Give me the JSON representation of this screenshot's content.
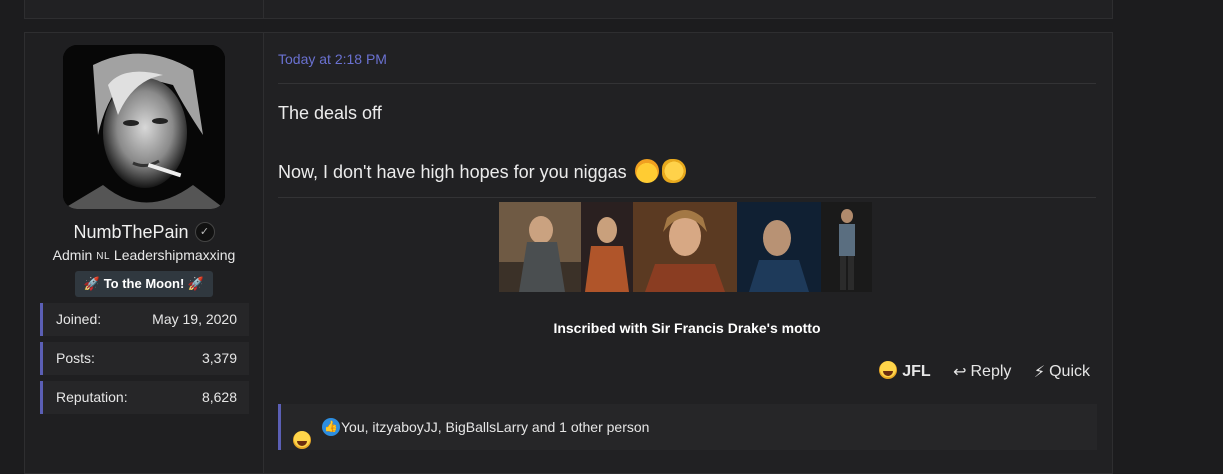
{
  "post": {
    "timestamp": "Today at 2:18 PM",
    "line1": "The deals off",
    "line2": "Now, I don't have high hopes for you niggas",
    "line2_emojis": [
      "exploding-head-emoji",
      "ok-hand-emoji"
    ]
  },
  "user": {
    "name": "NumbThePain",
    "title_prefix": "Admin",
    "title_flag": "NL",
    "title_suffix": "Leadershipmaxxing",
    "banner": "🚀 To the Moon! 🚀",
    "stats": [
      {
        "label": "Joined:",
        "value": "May 19, 2020"
      },
      {
        "label": "Posts:",
        "value": "3,379"
      },
      {
        "label": "Reputation:",
        "value": "8,628"
      }
    ]
  },
  "signature": {
    "caption": "Inscribed with Sir Francis Drake's motto",
    "images": [
      "gif-character-1",
      "gif-character-2",
      "gif-character-3",
      "gif-character-4",
      "gif-character-5"
    ]
  },
  "actions": {
    "jfl": "JFL",
    "reply": "Reply",
    "quick": "Quick"
  },
  "reactions": {
    "text": "You, itzyaboyJJ, BigBallsLarry and 1 other person",
    "icons": [
      "laughing-face-icon",
      "thumbs-up-icon"
    ]
  },
  "colors": {
    "accent": "#5b5fb5",
    "timestamp": "#6a71d0",
    "background": "#1c1c1e"
  }
}
